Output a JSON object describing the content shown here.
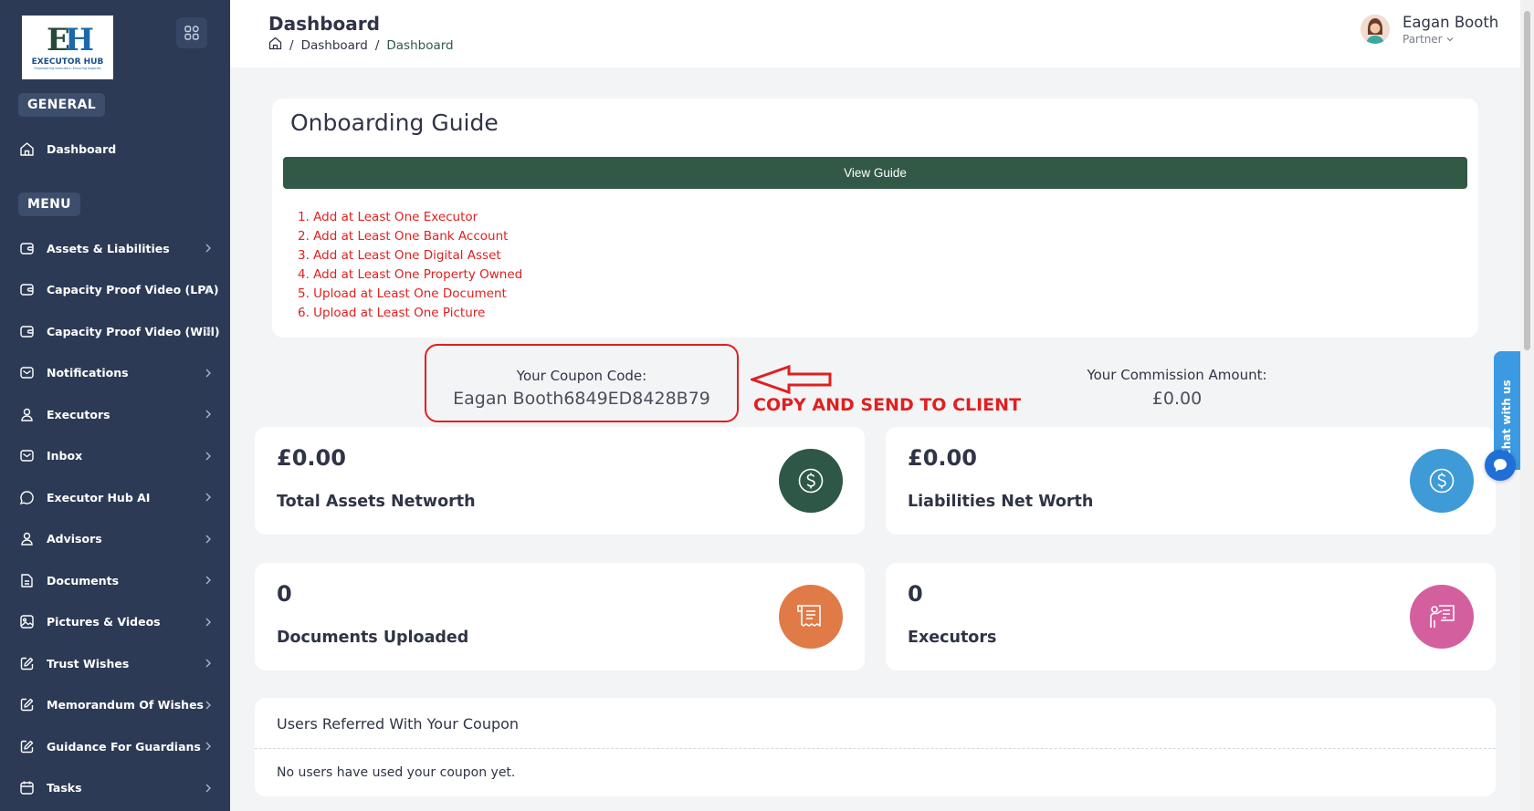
{
  "brand": {
    "logo_mark": "EH",
    "name": "EXECUTOR HUB",
    "tagline": "Empowering executors. Ensuring legacies"
  },
  "sidebar": {
    "section_general": "GENERAL",
    "section_menu": "MENU",
    "general_items": [
      {
        "label": "Dashboard",
        "icon": "home-icon"
      }
    ],
    "menu_items": [
      {
        "label": "Assets & Liabilities",
        "icon": "wallet-icon"
      },
      {
        "label": "Capacity Proof Video (LPA)",
        "icon": "wallet-icon"
      },
      {
        "label": "Capacity Proof Video (Will)",
        "icon": "wallet-icon"
      },
      {
        "label": "Notifications",
        "icon": "mail-icon"
      },
      {
        "label": "Executors",
        "icon": "user-icon"
      },
      {
        "label": "Inbox",
        "icon": "mail-icon"
      },
      {
        "label": "Executor Hub AI",
        "icon": "chat-icon"
      },
      {
        "label": "Advisors",
        "icon": "user-icon"
      },
      {
        "label": "Documents",
        "icon": "document-icon"
      },
      {
        "label": "Pictures & Videos",
        "icon": "image-icon"
      },
      {
        "label": "Trust Wishes",
        "icon": "edit-icon"
      },
      {
        "label": "Memorandum Of Wishes",
        "icon": "edit-icon"
      },
      {
        "label": "Guidance For Guardians",
        "icon": "edit-icon"
      },
      {
        "label": "Tasks",
        "icon": "calendar-icon"
      }
    ]
  },
  "header": {
    "title": "Dashboard",
    "breadcrumb": [
      "Dashboard",
      "Dashboard"
    ],
    "user_name": "Eagan Booth",
    "user_role": "Partner"
  },
  "onboarding": {
    "title": "Onboarding Guide",
    "button_label": "View Guide",
    "steps": [
      "1. Add at Least One Executor",
      "2. Add at Least One Bank Account",
      "3. Add at Least One Digital Asset",
      "4. Add at Least One Property Owned",
      "5. Upload at Least One Document",
      "6. Upload at Least One Picture"
    ]
  },
  "coupon": {
    "label": "Your Coupon Code:",
    "code": "Eagan Booth6849ED8428B79",
    "annotation": "COPY AND SEND TO CLIENT"
  },
  "commission": {
    "label": "Your Commission Amount:",
    "value": "£0.00"
  },
  "stats": [
    {
      "value": "£0.00",
      "label": "Total Assets Networth",
      "icon": "dollar-icon",
      "color": "#2e5747"
    },
    {
      "value": "£0.00",
      "label": "Liabilities Net Worth",
      "icon": "dollar-icon",
      "color": "#3e9bd8"
    },
    {
      "value": "0",
      "label": "Documents Uploaded",
      "icon": "receipt-icon",
      "color": "#e07a47"
    },
    {
      "value": "0",
      "label": "Executors",
      "icon": "presenter-icon",
      "color": "#d45f9f"
    }
  ],
  "referred": {
    "title": "Users Referred With Your Coupon",
    "empty_text": "No users have used your coupon yet."
  },
  "chat": {
    "label": "Chat with us"
  },
  "colors": {
    "sidebar": "#2c3a55",
    "primary_green": "#325846",
    "annotation_red": "#e02020"
  }
}
